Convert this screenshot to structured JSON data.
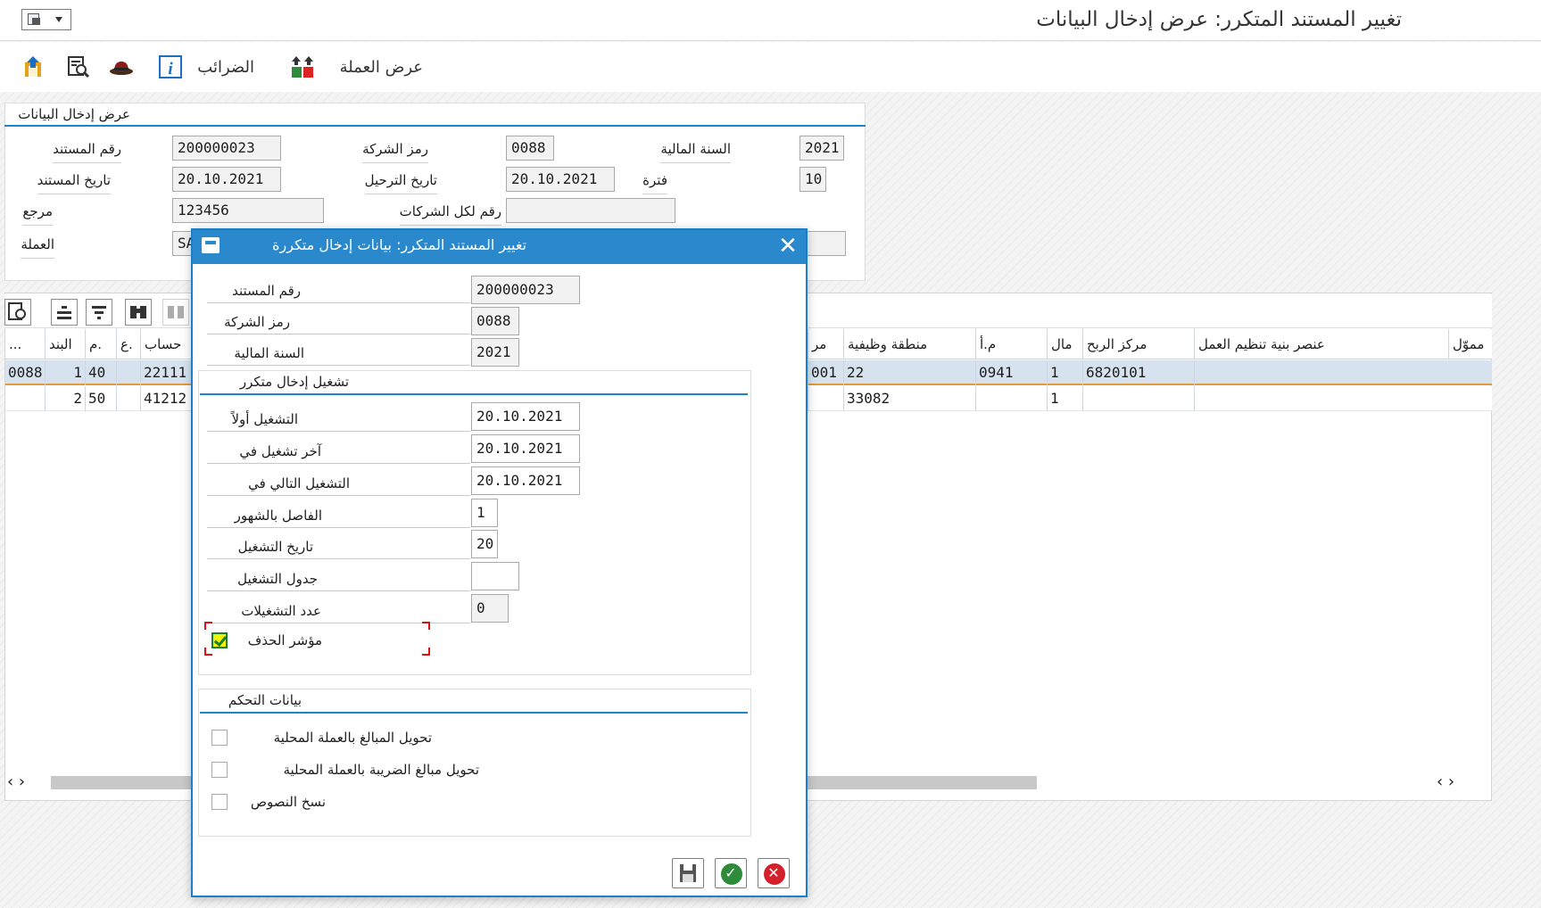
{
  "title": "تغيير المستند المتكرر: عرض إدخال البيانات",
  "toolbar": {
    "currency_display": "عرض العملة",
    "taxes": "الضرائب"
  },
  "header": {
    "section_title": "عرض إدخال البيانات",
    "doc_number_label": "رقم المستند",
    "doc_number": "200000023",
    "company_code_label": "رمز الشركة",
    "company_code": "0088",
    "fiscal_year_label": "السنة المالية",
    "fiscal_year": "2021",
    "doc_date_label": "تاريخ المستند",
    "doc_date": "20.10.2021",
    "posting_date_label": "تاريخ الترحيل",
    "posting_date": "20.10.2021",
    "period_label": "فترة",
    "period": "10",
    "reference_label": "مرجع",
    "reference": "123456",
    "cross_company_label": "رقم لكل الشركات",
    "cross_company": "",
    "currency_label": "العملة",
    "currency": "SA"
  },
  "grid": {
    "columns": [
      "...",
      "البند",
      "م.",
      "ع.",
      "حساب",
      "مر",
      "منطقة وظيفية",
      "م.أ",
      "مال",
      "مركز الربح",
      "عنصر بنية تنظيم العمل",
      "مموّل"
    ],
    "rows": [
      {
        "company": "0088",
        "item": "1",
        "pk": "40",
        "account": "22111",
        "partial": "001",
        "func_area": "22",
        "bu": "0941",
        "fund": "1",
        "profit_center": "6820101",
        "wbs": ""
      },
      {
        "company": "",
        "item": "2",
        "pk": "50",
        "account": "41212",
        "partial": "",
        "func_area": "33082",
        "bu": "",
        "fund": "1",
        "profit_center": "",
        "wbs": ""
      }
    ]
  },
  "dialog": {
    "title": "تغيير المستند المتكرر: بيانات إدخال متكررة",
    "doc_number_label": "رقم المستند",
    "doc_number": "200000023",
    "company_code_label": "رمز الشركة",
    "company_code": "0088",
    "fiscal_year_label": "السنة المالية",
    "fiscal_year": "2021",
    "run_group_title": "تشغيل إدخال متكرر",
    "first_run_label": "التشغيل أولاً",
    "first_run": "20.10.2021",
    "last_run_label": "آخر تشغيل في",
    "last_run": "20.10.2021",
    "next_run_label": "التشغيل التالي في",
    "next_run": "20.10.2021",
    "interval_label": "الفاصل بالشهور",
    "interval": "1",
    "run_date_label": "تاريخ التشغيل",
    "run_date": "20",
    "schedule_label": "جدول التشغيل",
    "schedule": "",
    "num_runs_label": "عدد التشغيلات",
    "num_runs": "0",
    "deletion_label": "مؤشر الحذف",
    "deletion_checked": true,
    "control_group_title": "بيانات التحكم",
    "convert_amounts_label": "تحويل المبالغ بالعملة المحلية",
    "convert_tax_label": "تحويل مبالغ الضريبة بالعملة المحلية",
    "copy_texts_label": "نسخ النصوص"
  }
}
